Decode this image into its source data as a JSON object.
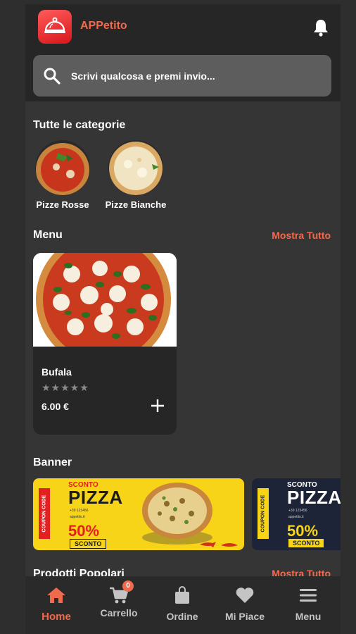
{
  "header": {
    "app_title": "APPetito",
    "search_placeholder": "Scrivi qualcosa e premi invio..."
  },
  "categories": {
    "title": "Tutte le categorie",
    "items": [
      {
        "label": "Pizze Rosse"
      },
      {
        "label": "Pizze Bianche"
      }
    ]
  },
  "menu": {
    "title": "Menu",
    "see_all": "Mostra Tutto",
    "items": [
      {
        "name": "Bufala",
        "stars": "★★★★★",
        "rating": 0,
        "price": "6.00 €"
      }
    ]
  },
  "banner": {
    "title": "Banner",
    "items": [
      {
        "coupon": "COUPON CODE",
        "sconto_top": "SCONTO",
        "headline": "PIZZA",
        "discount": "50%",
        "sconto_label": "SCONTO",
        "contact_1": "+39 123456",
        "contact_2": "appetito.it",
        "bg": "#f7d417"
      },
      {
        "coupon": "COUPON CODE",
        "sconto_top": "SCONTO",
        "headline": "PIZZA",
        "discount": "50%",
        "sconto_label": "SCONTO",
        "contact_1": "+39 123456",
        "contact_2": "appetito.it",
        "bg": "#1d2437"
      }
    ]
  },
  "next_section": {
    "title": "Prodotti Popolari",
    "see_all": "Mostra Tutto"
  },
  "nav": {
    "items": [
      {
        "label": "Home",
        "icon": "home-icon",
        "active": true
      },
      {
        "label": "Carrello",
        "icon": "cart-icon",
        "badge": "0"
      },
      {
        "label": "Ordine",
        "icon": "bag-icon"
      },
      {
        "label": "Mi Piace",
        "icon": "heart-icon"
      },
      {
        "label": "Menu",
        "icon": "hamburger-icon"
      }
    ]
  },
  "colors": {
    "accent": "#f06a4d",
    "background": "#353535",
    "header": "#262626"
  }
}
